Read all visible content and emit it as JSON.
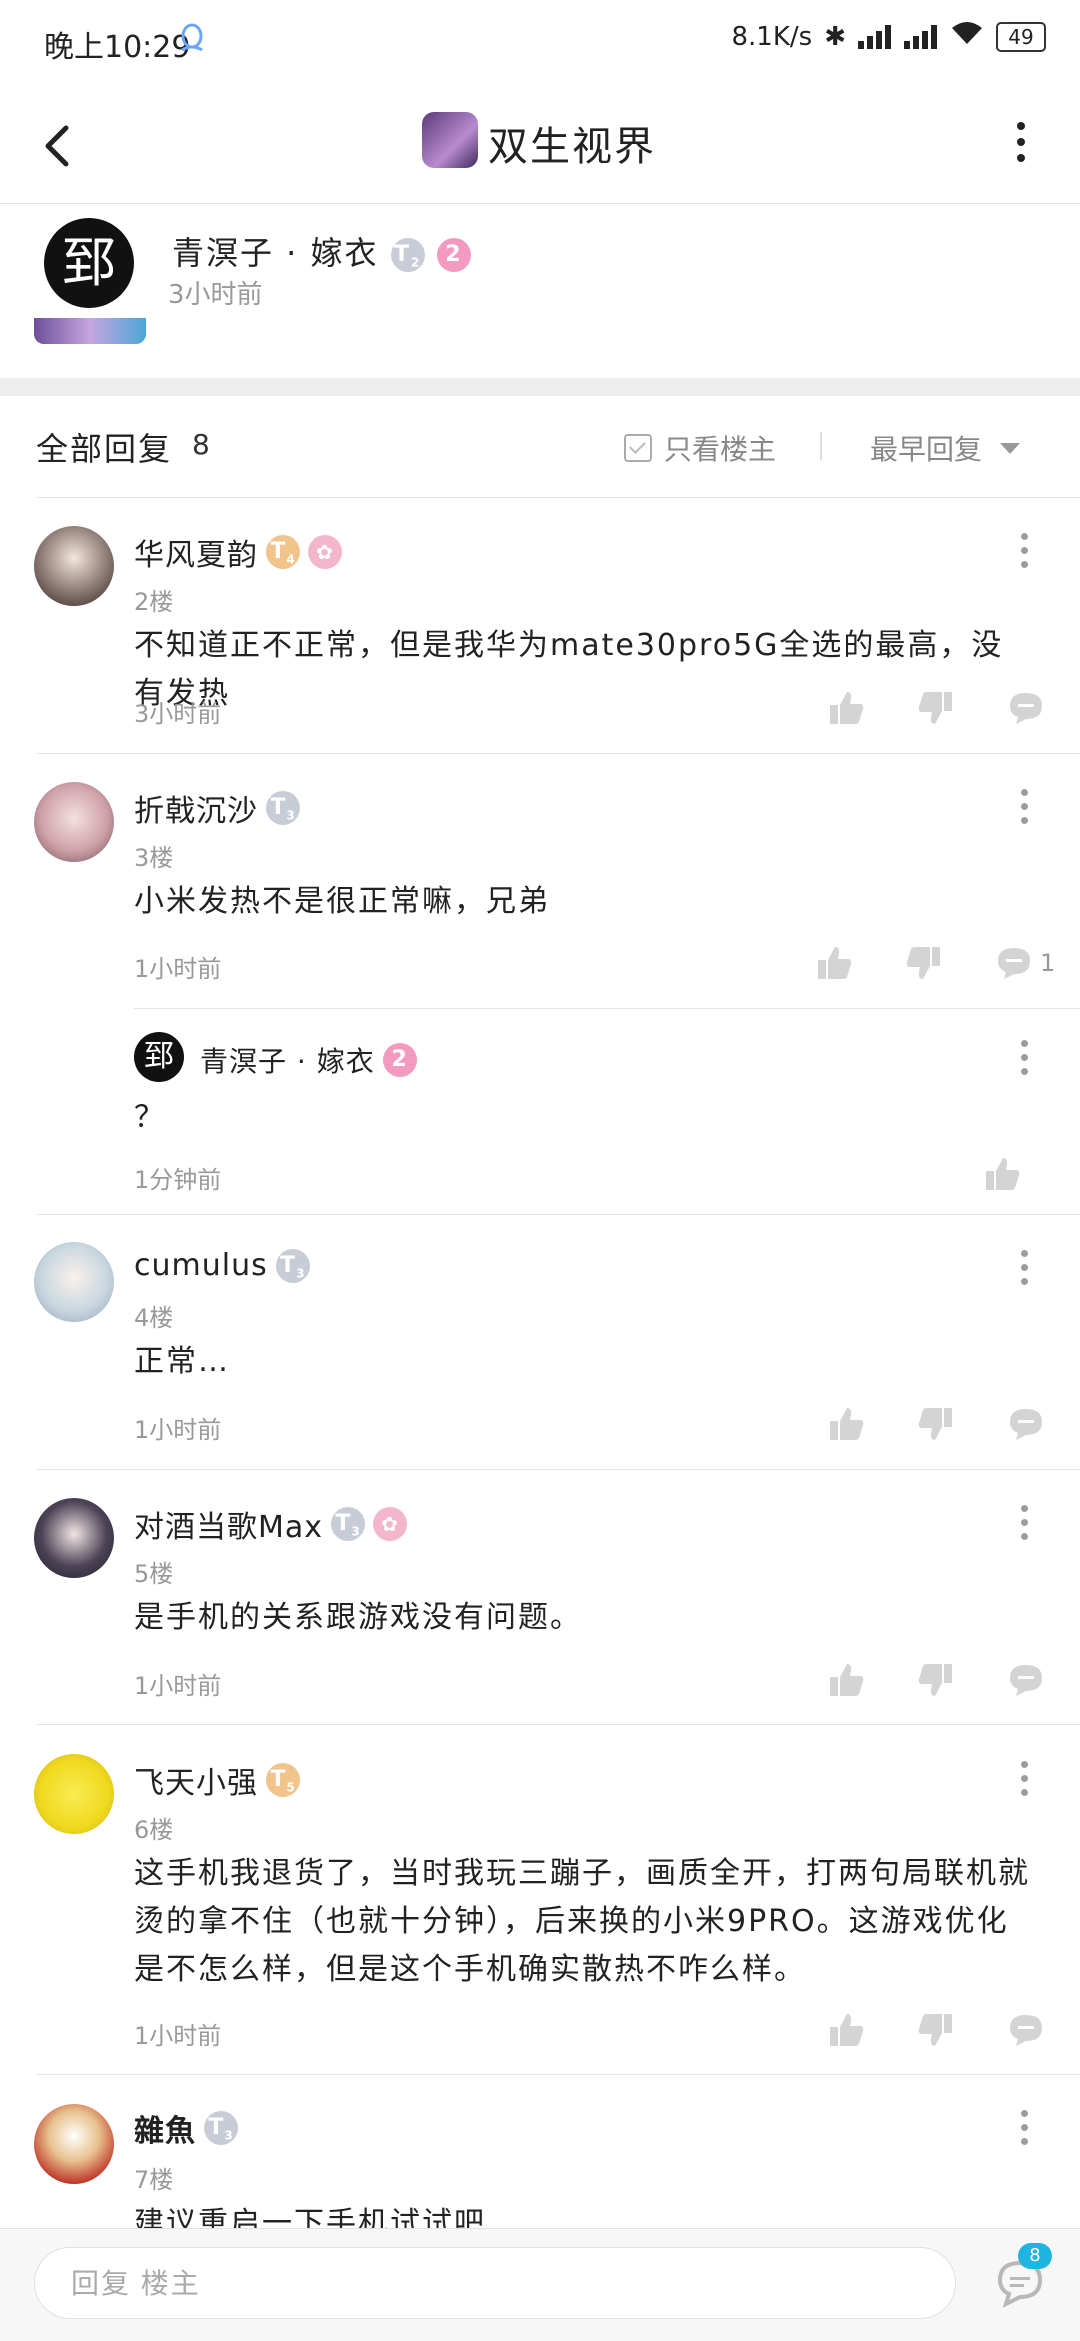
{
  "status_bar": {
    "time": "晚上10:29",
    "network_speed": "8.1K/s",
    "battery": "49",
    "icons": [
      "qq-icon",
      "bluetooth-icon",
      "hd-signal-icon",
      "signal-icon",
      "wifi-icon",
      "battery-icon"
    ]
  },
  "header": {
    "title": "双生视界",
    "icons": [
      "back-arrow-icon",
      "forum-avatar-icon",
      "more-vertical-icon"
    ]
  },
  "original_post": {
    "author": "青溟子 · 嫁衣",
    "time": "3小时前",
    "avatar_char": "郅",
    "badge_t": "T",
    "badge_t_level": "2",
    "badge_level": "2"
  },
  "reply_header": {
    "label": "全部回复",
    "count": "8",
    "only_op": "只看楼主",
    "sort": "最早回复"
  },
  "comments": [
    {
      "name": "华风夏韵",
      "floor": "2楼",
      "text": "不知道正不正常，但是我华为mate30pro5G全选的最高，没有发热",
      "time": "3小时前",
      "badge_t": "T",
      "badge_t_level": "4",
      "reply_count": ""
    },
    {
      "name": "折戟沉沙",
      "floor": "3楼",
      "text": "小米发热不是很正常嘛，兄弟",
      "time": "1小时前",
      "badge_t": "T",
      "badge_t_level": "3",
      "reply_count": "1"
    },
    {
      "name": "cumulus",
      "floor": "4楼",
      "text": "正常…",
      "time": "1小时前",
      "badge_t": "T",
      "badge_t_level": "3",
      "reply_count": ""
    },
    {
      "name": "对酒当歌Max",
      "floor": "5楼",
      "text": "是手机的关系跟游戏没有问题。",
      "time": "1小时前",
      "badge_t": "T",
      "badge_t_level": "3",
      "reply_count": ""
    },
    {
      "name": "飞天小强",
      "floor": "6楼",
      "text": "这手机我退货了，当时我玩三蹦子，画质全开，打两句局联机就烫的拿不住（也就十分钟），后来换的小米9PRO。这游戏优化是不怎么样，但是这个手机确实散热不咋么样。",
      "time": "1小时前",
      "badge_t": "T",
      "badge_t_level": "5",
      "reply_count": ""
    },
    {
      "name": "雜魚",
      "floor": "7楼",
      "text": "建议重启一下手机试试吧",
      "time": "",
      "badge_t": "T",
      "badge_t_level": "3",
      "reply_count": ""
    }
  ],
  "sub_reply": {
    "name": "青溟子 · 嫁衣",
    "text": "？",
    "time": "1分钟前",
    "avatar_char": "郅",
    "badge_level": "2"
  },
  "bottom_bar": {
    "placeholder": "回复  楼主",
    "reply_badge": "8"
  },
  "colors": {
    "accent": "#1fb5e0",
    "gold_badge": "#f0c48b",
    "grey_badge": "#c8ccd6",
    "pink_badge": "#f39ac1",
    "meta_text": "#999999"
  }
}
